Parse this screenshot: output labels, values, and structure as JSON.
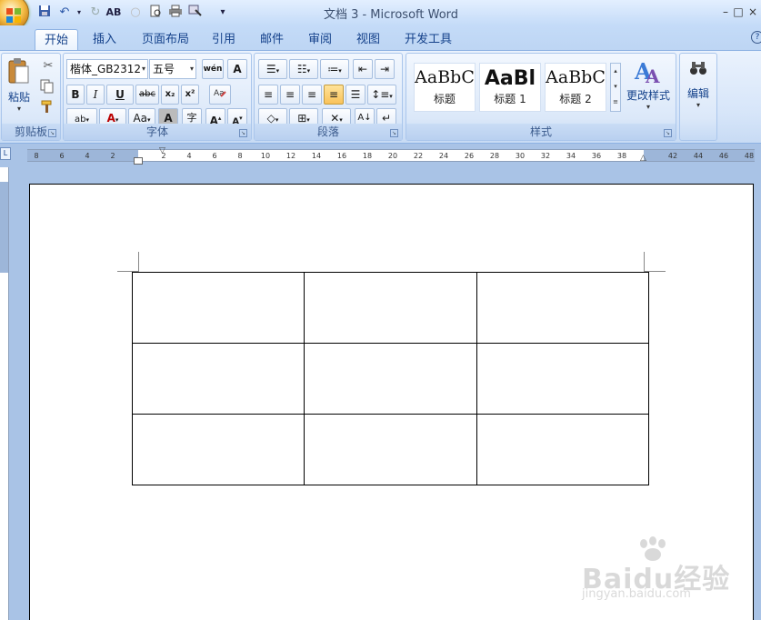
{
  "window": {
    "title": "文档 3 - Microsoft Word",
    "controls": [
      "–",
      "□",
      "×"
    ]
  },
  "quick_access": {
    "icons": [
      "save-icon",
      "undo-icon",
      "redo-icon",
      "spelling-icon",
      "blank-icon",
      "print-preview-icon",
      "print-icon",
      "draw-icon"
    ],
    "customize_label": "▾"
  },
  "tabs": [
    "开始",
    "插入",
    "页面布局",
    "引用",
    "邮件",
    "审阅",
    "视图",
    "开发工具"
  ],
  "active_tab": "开始",
  "ribbon": {
    "clipboard": {
      "paste_label": "粘贴",
      "group_label": "剪贴板"
    },
    "font": {
      "font_name": "楷体_GB2312",
      "font_size": "五号",
      "bold": "B",
      "italic": "I",
      "underline": "U",
      "strike": "abc",
      "subscript": "x₂",
      "superscript": "x²",
      "change_case": "Aa",
      "char_shading": "A",
      "enclose": "字",
      "grow": "A",
      "shrink": "A",
      "wen": "wén",
      "border_a": "A",
      "highlight_color": "#ff00ff",
      "font_color": "#ff0000",
      "group_label": "字体"
    },
    "paragraph": {
      "group_label": "段落"
    },
    "styles": {
      "cards": [
        {
          "sample": "AaBbC",
          "name": "标题"
        },
        {
          "sample": "AaBl",
          "name": "标题 1"
        },
        {
          "sample": "AaBbC",
          "name": "标题 2"
        }
      ],
      "change_styles_label": "更改样式",
      "group_label": "样式"
    },
    "editing": {
      "label": "编辑"
    }
  },
  "ruler": {
    "ticks": [
      "8",
      "6",
      "4",
      "2",
      "",
      "2",
      "4",
      "6",
      "8",
      "10",
      "12",
      "14",
      "16",
      "18",
      "20",
      "22",
      "24",
      "26",
      "28",
      "30",
      "32",
      "34",
      "36",
      "38",
      "",
      "42",
      "44",
      "46",
      "48"
    ]
  },
  "document": {
    "table": {
      "rows": 3,
      "cols": 3
    }
  },
  "watermark": {
    "text": "Baidu经验",
    "sub": "jingyan.baidu.com"
  }
}
